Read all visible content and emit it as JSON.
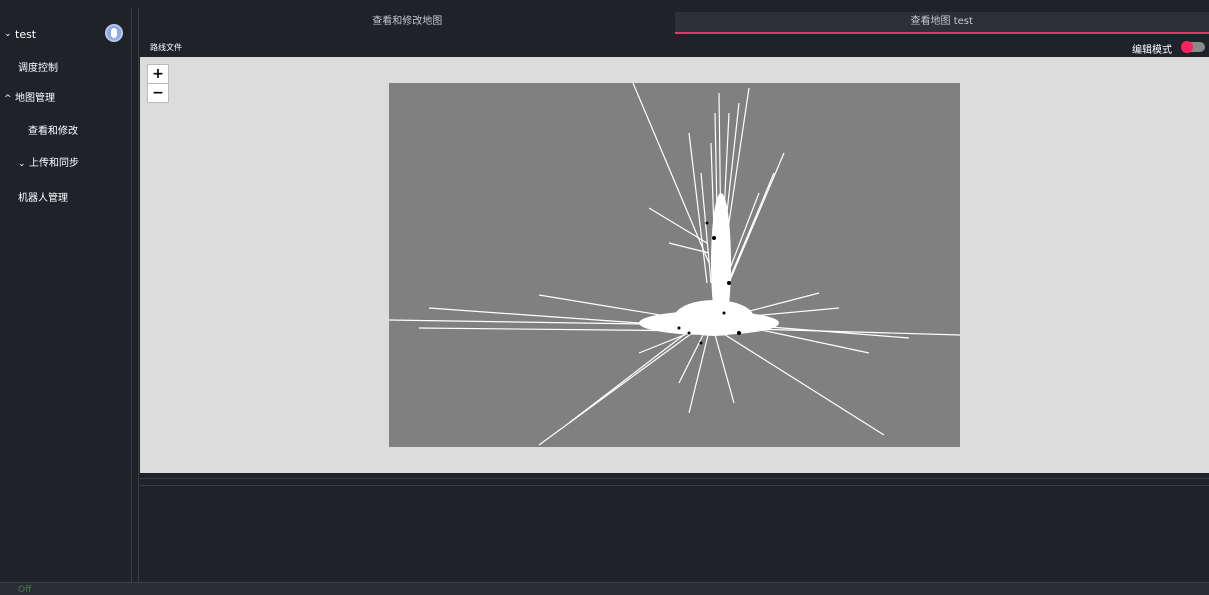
{
  "sidebar": {
    "project": "test",
    "items": [
      {
        "label": "调度控制"
      },
      {
        "label": "地图管理"
      },
      {
        "label": "查看和修改"
      },
      {
        "label": "上传和同步"
      },
      {
        "label": "机器人管理"
      }
    ]
  },
  "tabs": [
    {
      "label": "查看和修改地图"
    },
    {
      "label": "查看地图 test"
    }
  ],
  "toolbar": {
    "file_label": "路线文件",
    "edit_mode_label": "编辑模式"
  },
  "zoom": {
    "in": "+",
    "out": "−"
  },
  "status": {
    "text": "Off"
  },
  "colors": {
    "accent": "#e8336b",
    "toggle_knob": "#ff2060",
    "map_bg": "#808080",
    "viewport_bg": "#dcdcdc"
  }
}
